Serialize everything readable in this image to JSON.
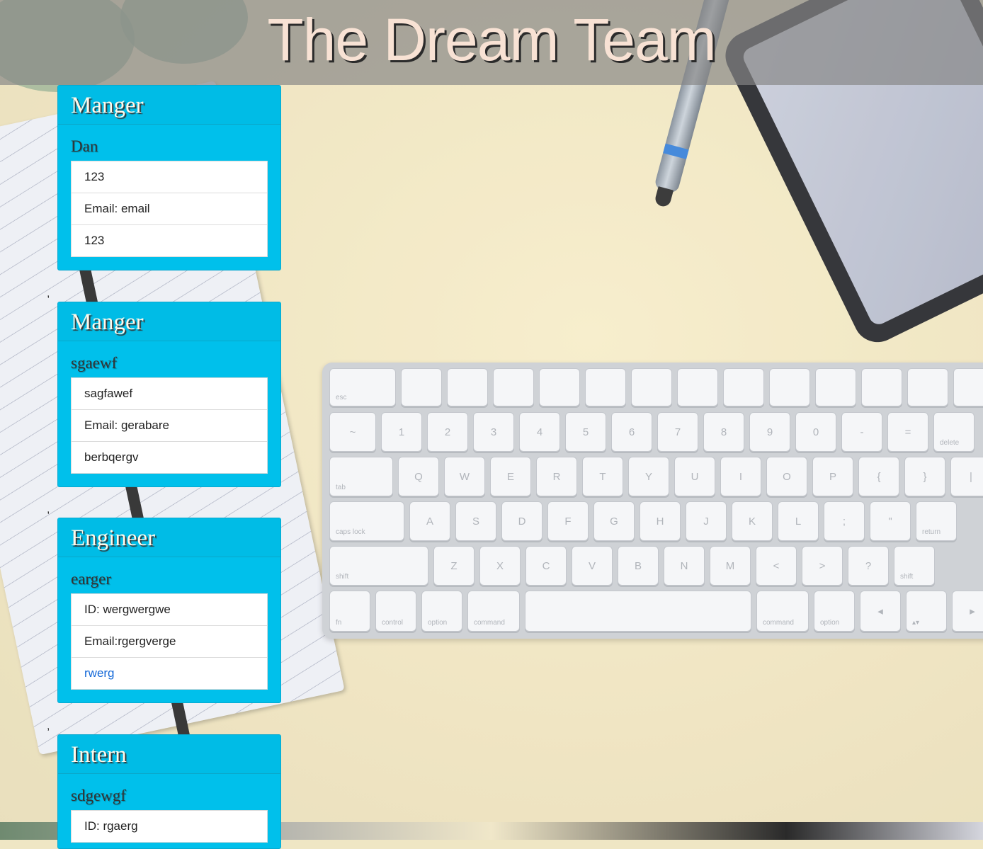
{
  "header": {
    "title": "The Dream Team"
  },
  "separator": ",",
  "cards": [
    {
      "role": "Manger",
      "name": "Dan",
      "lines": [
        "123",
        "Email: email",
        "123"
      ]
    },
    {
      "role": "Manger",
      "name": "sgaewf",
      "lines": [
        "sagfawef",
        "Email: gerabare",
        "berbqergv"
      ]
    },
    {
      "role": "Engineer",
      "name": "earger",
      "lines": [
        "ID: wergwergwe",
        "Email:rgergverge"
      ],
      "link": "rwerg"
    },
    {
      "role": "Intern",
      "name": "sdgewgf",
      "lines": [
        "ID: rgaerg"
      ]
    }
  ],
  "keyboard": {
    "row1": [
      "esc",
      "",
      "",
      "",
      "",
      "",
      "",
      "",
      "",
      "",
      "",
      "",
      "",
      ""
    ],
    "row2": [
      "~",
      "1",
      "2",
      "3",
      "4",
      "5",
      "6",
      "7",
      "8",
      "9",
      "0",
      "-",
      "=",
      "delete"
    ],
    "row3": [
      "tab",
      "Q",
      "W",
      "E",
      "R",
      "T",
      "Y",
      "U",
      "I",
      "O",
      "P",
      "{",
      "}",
      "|"
    ],
    "row4": [
      "caps lock",
      "A",
      "S",
      "D",
      "F",
      "G",
      "H",
      "J",
      "K",
      "L",
      ";",
      "\"",
      "return"
    ],
    "row5": [
      "shift",
      "Z",
      "X",
      "C",
      "V",
      "B",
      "N",
      "M",
      "<",
      ">",
      "?",
      "shift"
    ],
    "row6": [
      "fn",
      "control",
      "option",
      "command",
      "",
      "command",
      "option",
      "◂",
      "▴▾",
      "▸"
    ]
  }
}
